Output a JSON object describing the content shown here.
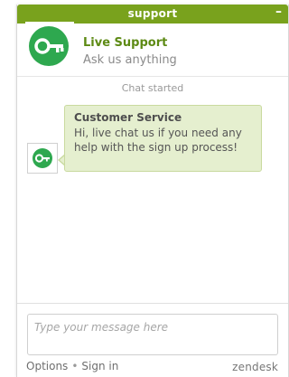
{
  "header": {
    "title": "support",
    "minimize_label": "–"
  },
  "brand": {
    "title": "Live Support",
    "subtitle": "Ask us anything",
    "logo_icon": "key-icon",
    "accent": "#79a21d",
    "logo_color": "#2ea84f"
  },
  "chat": {
    "started_label": "Chat started",
    "messages": [
      {
        "sender": "Customer Service",
        "text": "Hi, live chat us if you need any help with the sign up process!"
      }
    ]
  },
  "composer": {
    "placeholder": "Type your message here"
  },
  "footer": {
    "options_label": "Options",
    "separator": "•",
    "signin_label": "Sign in",
    "powered_by": "zendesk"
  }
}
